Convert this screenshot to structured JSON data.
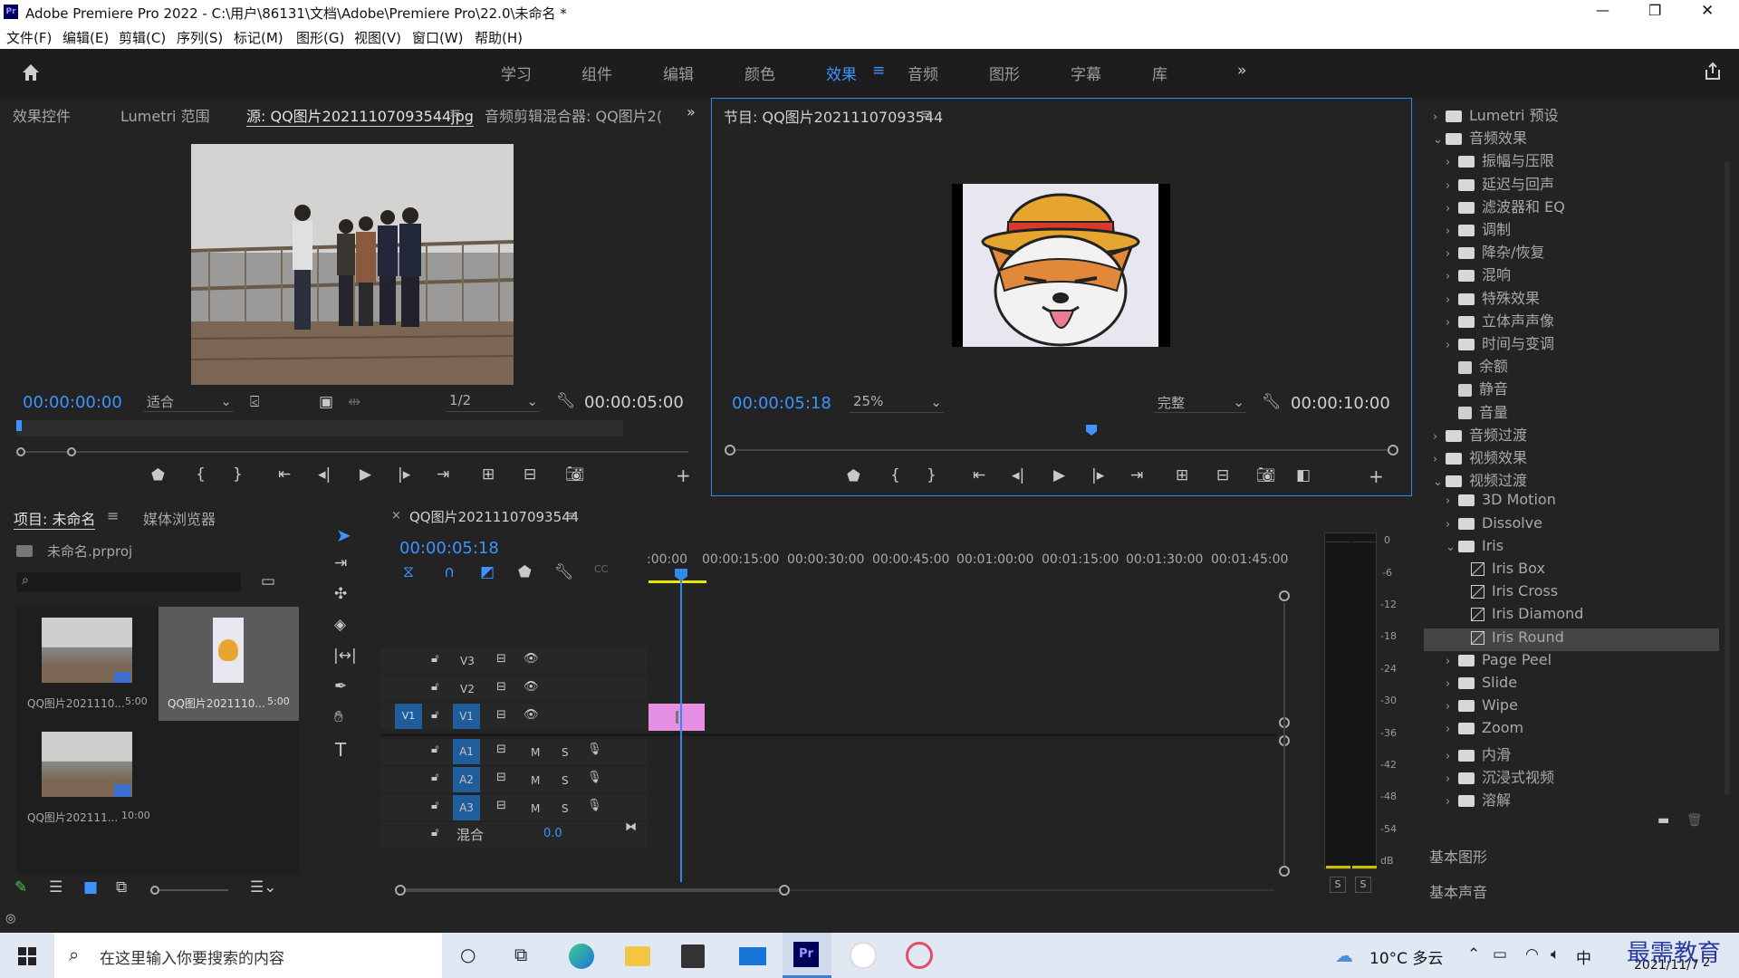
{
  "titlebar": {
    "title": "Adobe Premiere Pro 2022 - C:\\用户\\86131\\文档\\Adobe\\Premiere Pro\\22.0\\未命名 *",
    "min": "—",
    "max": "❐",
    "close": "✕"
  },
  "menu": [
    "文件(F)",
    "编辑(E)",
    "剪辑(C)",
    "序列(S)",
    "标记(M)",
    "图形(G)",
    "视图(V)",
    "窗口(W)",
    "帮助(H)"
  ],
  "workspace": {
    "tabs": [
      "学习",
      "组件",
      "编辑",
      "颜色",
      "效果",
      "音频",
      "图形",
      "字幕",
      "库"
    ],
    "active": "效果",
    "more": "»"
  },
  "source": {
    "tabs": [
      "效果控件",
      "Lumetri 范围",
      "源: QQ图片20211107093544jpg",
      "音频剪辑混合器: QQ图片2("
    ],
    "timecode_in": "00:00:00:00",
    "fit": "适合",
    "resolution": "1/2",
    "duration": "00:00:05:00"
  },
  "program": {
    "title": "节目: QQ图片20211107093544",
    "timecode": "00:00:05:18",
    "zoom": "25%",
    "quality": "完整",
    "duration": "00:00:10:00"
  },
  "project": {
    "tabs": [
      "项目: 未命名",
      "媒体浏览器"
    ],
    "file": "未命名.prproj",
    "items": [
      {
        "name": "QQ图片2021110...",
        "dur": "5:00"
      },
      {
        "name": "QQ图片2021110...",
        "dur": "5:00"
      },
      {
        "name": "QQ图片202111...",
        "dur": "10:00"
      }
    ]
  },
  "timeline": {
    "seq_tab": "QQ图片20211107093544",
    "timecode": "00:00:05:18",
    "ruler": [
      ":00:00",
      "00:00:15:00",
      "00:00:30:00",
      "00:00:45:00",
      "00:01:00:00",
      "00:01:15:00",
      "00:01:30:00",
      "00:01:45:00"
    ],
    "video_tracks": [
      "V3",
      "V2",
      "V1"
    ],
    "audio_tracks": [
      "A1",
      "A2",
      "A3"
    ],
    "source_patch": "V1",
    "mix_label": "混合",
    "mix_value": "0.0",
    "m": "M",
    "s": "S"
  },
  "meter": {
    "labels": [
      "0",
      "-6",
      "-12",
      "-18",
      "-24",
      "-30",
      "-36",
      "-42",
      "-48",
      "-54",
      "dB"
    ],
    "solo": [
      "S",
      "S"
    ]
  },
  "effects": {
    "rows": [
      {
        "label": "Lumetri 预设",
        "kind": "folder",
        "indent": 0,
        "state": "closed"
      },
      {
        "label": "音频效果",
        "kind": "folder",
        "indent": 0,
        "state": "open"
      },
      {
        "label": "振幅与压限",
        "kind": "folder",
        "indent": 1,
        "state": "closed"
      },
      {
        "label": "延迟与回声",
        "kind": "folder",
        "indent": 1,
        "state": "closed"
      },
      {
        "label": "滤波器和 EQ",
        "kind": "folder",
        "indent": 1,
        "state": "closed"
      },
      {
        "label": "调制",
        "kind": "folder",
        "indent": 1,
        "state": "closed"
      },
      {
        "label": "降杂/恢复",
        "kind": "folder",
        "indent": 1,
        "state": "closed"
      },
      {
        "label": "混响",
        "kind": "folder",
        "indent": 1,
        "state": "closed"
      },
      {
        "label": "特殊效果",
        "kind": "folder",
        "indent": 1,
        "state": "closed"
      },
      {
        "label": "立体声声像",
        "kind": "folder",
        "indent": 1,
        "state": "closed"
      },
      {
        "label": "时间与变调",
        "kind": "folder",
        "indent": 1,
        "state": "closed"
      },
      {
        "label": "余额",
        "kind": "audio",
        "indent": 1,
        "state": ""
      },
      {
        "label": "静音",
        "kind": "audio",
        "indent": 1,
        "state": ""
      },
      {
        "label": "音量",
        "kind": "audio",
        "indent": 1,
        "state": ""
      },
      {
        "label": "音频过渡",
        "kind": "folder",
        "indent": 0,
        "state": "closed"
      },
      {
        "label": "视频效果",
        "kind": "folder",
        "indent": 0,
        "state": "closed"
      },
      {
        "label": "视频过渡",
        "kind": "folder",
        "indent": 0,
        "state": "open"
      },
      {
        "label": "3D Motion",
        "kind": "folder",
        "indent": 1,
        "state": "closed"
      },
      {
        "label": "Dissolve",
        "kind": "folder",
        "indent": 1,
        "state": "closed"
      },
      {
        "label": "Iris",
        "kind": "folder",
        "indent": 1,
        "state": "open"
      },
      {
        "label": "Iris Box",
        "kind": "fx",
        "indent": 2,
        "state": ""
      },
      {
        "label": "Iris Cross",
        "kind": "fx",
        "indent": 2,
        "state": ""
      },
      {
        "label": "Iris Diamond",
        "kind": "fx",
        "indent": 2,
        "state": ""
      },
      {
        "label": "Iris Round",
        "kind": "fx",
        "indent": 2,
        "state": "selected"
      },
      {
        "label": "Page Peel",
        "kind": "folder",
        "indent": 1,
        "state": "closed"
      },
      {
        "label": "Slide",
        "kind": "folder",
        "indent": 1,
        "state": "closed"
      },
      {
        "label": "Wipe",
        "kind": "folder",
        "indent": 1,
        "state": "closed"
      },
      {
        "label": "Zoom",
        "kind": "folder",
        "indent": 1,
        "state": "closed"
      },
      {
        "label": "内滑",
        "kind": "folder",
        "indent": 1,
        "state": "closed"
      },
      {
        "label": "沉浸式视频",
        "kind": "folder",
        "indent": 1,
        "state": "closed"
      },
      {
        "label": "溶解",
        "kind": "folder",
        "indent": 1,
        "state": "closed"
      }
    ],
    "bottom_panels": [
      "基本图形",
      "基本声音"
    ]
  },
  "taskbar": {
    "search_placeholder": "在这里输入你要搜索的内容",
    "weather": "10°C 多云",
    "ime": "中",
    "date": "2021/11/7",
    "watermark": "最需教育",
    "notif": "2"
  },
  "colors": {
    "accent": "#3e93ff",
    "clip": "#e48ee4",
    "playhead": "#2d8ceb",
    "selected_row": "#454545"
  }
}
